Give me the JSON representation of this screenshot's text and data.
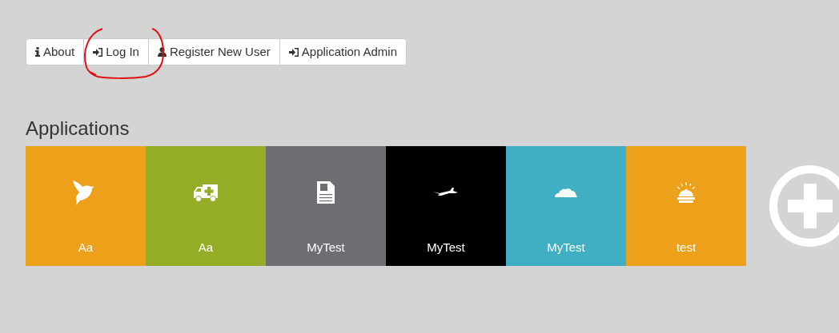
{
  "nav_buttons": [
    {
      "label": "About"
    },
    {
      "label": "Log In"
    },
    {
      "label": "Register New User"
    },
    {
      "label": "Application Admin"
    }
  ],
  "heading": "Applications",
  "tiles": [
    {
      "name": "Aa",
      "color": "#eda01a"
    },
    {
      "name": "Aa",
      "color": "#94ad26"
    },
    {
      "name": "MyTest",
      "color": "#6d6e72"
    },
    {
      "name": "MyTest",
      "color": "#000000"
    },
    {
      "name": "MyTest",
      "color": "#40aec3"
    },
    {
      "name": "test",
      "color": "#eda01a"
    }
  ]
}
